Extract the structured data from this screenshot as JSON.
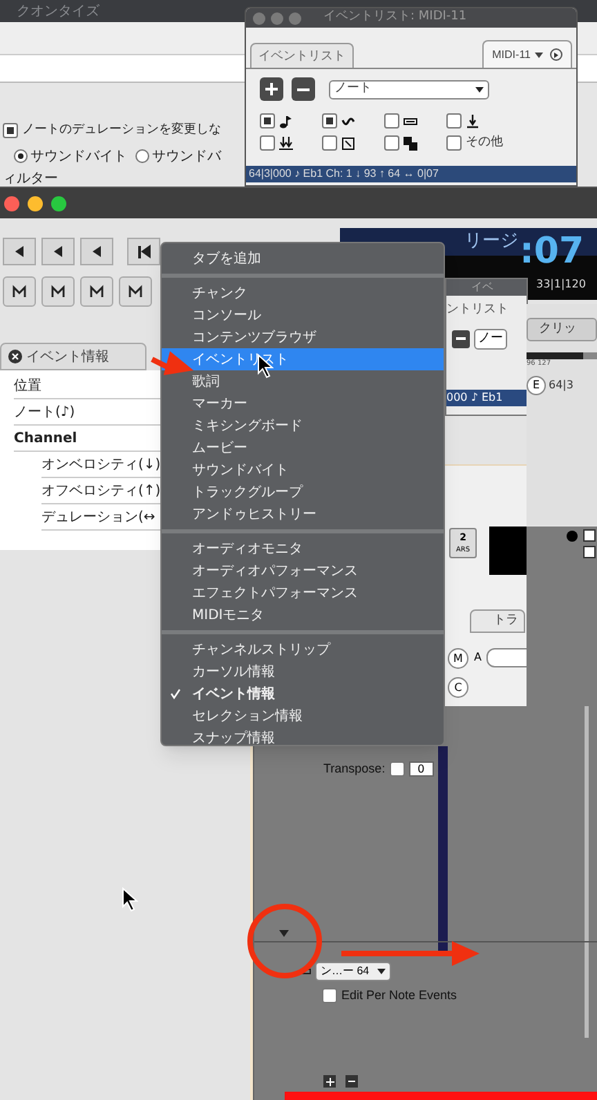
{
  "quantize_window": {
    "title": "クオンタイズ",
    "option": {
      "label": "ノートのデュレーションを変更しな",
      "checked": true
    },
    "radios": [
      {
        "label": "サウンドバイト",
        "selected": true
      },
      {
        "label": "サウンドバ",
        "selected": false
      }
    ],
    "section_label": "ィルター"
  },
  "event_list_window": {
    "title": "イベントリスト: MIDI-11",
    "tab": "イベントリスト",
    "track": "MIDI-11",
    "type_select": "ノート",
    "filters": [
      {
        "kind": "note",
        "checked": true
      },
      {
        "kind": "controller",
        "checked": true
      },
      {
        "kind": "program",
        "checked": false
      },
      {
        "kind": "pressure",
        "checked": false
      },
      {
        "kind": "polypressure",
        "checked": false
      },
      {
        "kind": "sysex",
        "checked": false
      },
      {
        "kind": "patch",
        "checked": false
      },
      {
        "kind": "other",
        "checked": false,
        "label": "その他"
      }
    ],
    "status": "64|3|000 ♪ Eb1 Ch: 1 ↓ 93 ↑ 64 ↔ 0|07"
  },
  "event_info": {
    "tab": "イベント情報",
    "rows": [
      {
        "label": "位置"
      },
      {
        "label": "ノート(♪)"
      },
      {
        "label": "Channel",
        "children": [
          {
            "label": "オンベロシティ(↓)"
          },
          {
            "label": "オフベロシティ(↑)"
          },
          {
            "label": "デュレーション(↔"
          }
        ]
      }
    ]
  },
  "counter": {
    "region_label": "リージ",
    "time": ":07",
    "position": "33|1|120"
  },
  "back_event_list": {
    "title": "イベ",
    "tab": "ントリスト",
    "type_select": "ノー",
    "status": "000 ♪ Eb1"
  },
  "inspector": {
    "clip_button": "クリッ",
    "slider_reading": "96 127",
    "level": 0.8,
    "edit_button": "E",
    "edit_value": "64|3",
    "mute_button": "M",
    "a_label": "A",
    "c_button": "C",
    "track_tab": "トラ",
    "bars_button": {
      "value": "2",
      "unit": "ARS"
    }
  },
  "midi_panel": {
    "transpose_label": "Transpose:",
    "transpose_on": false,
    "transpose_value": "0",
    "controller_select": "ン…ー 64",
    "edit_per_note": {
      "label": "Edit Per Note Events",
      "checked": false
    }
  },
  "menu": {
    "sections": [
      [
        {
          "label": "タブを追加",
          "selected": false,
          "checked": false
        }
      ],
      [
        {
          "label": "チャンク",
          "selected": false,
          "checked": false
        },
        {
          "label": "コンソール",
          "selected": false,
          "checked": false
        },
        {
          "label": "コンテンツブラウザ",
          "selected": false,
          "checked": false
        },
        {
          "label": "イベントリスト",
          "selected": true,
          "checked": false
        },
        {
          "label": "歌詞",
          "selected": false,
          "checked": false
        },
        {
          "label": "マーカー",
          "selected": false,
          "checked": false
        },
        {
          "label": "ミキシングボード",
          "selected": false,
          "checked": false
        },
        {
          "label": "ムービー",
          "selected": false,
          "checked": false
        },
        {
          "label": "サウンドバイト",
          "selected": false,
          "checked": false
        },
        {
          "label": "トラックグループ",
          "selected": false,
          "checked": false
        },
        {
          "label": "アンドゥヒストリー",
          "selected": false,
          "checked": false
        }
      ],
      [
        {
          "label": "オーディオモニタ",
          "selected": false,
          "checked": false
        },
        {
          "label": "オーディオパフォーマンス",
          "selected": false,
          "checked": false
        },
        {
          "label": "エフェクトパフォーマンス",
          "selected": false,
          "checked": false
        },
        {
          "label": "MIDIモニタ",
          "selected": false,
          "checked": false
        }
      ],
      [
        {
          "label": "チャンネルストリップ",
          "selected": false,
          "checked": false
        },
        {
          "label": "カーソル情報",
          "selected": false,
          "checked": false
        },
        {
          "label": "イベント情報",
          "selected": false,
          "checked": true
        },
        {
          "label": "セレクション情報",
          "selected": false,
          "checked": false
        },
        {
          "label": "スナップ情報",
          "selected": false,
          "checked": false
        }
      ]
    ]
  }
}
